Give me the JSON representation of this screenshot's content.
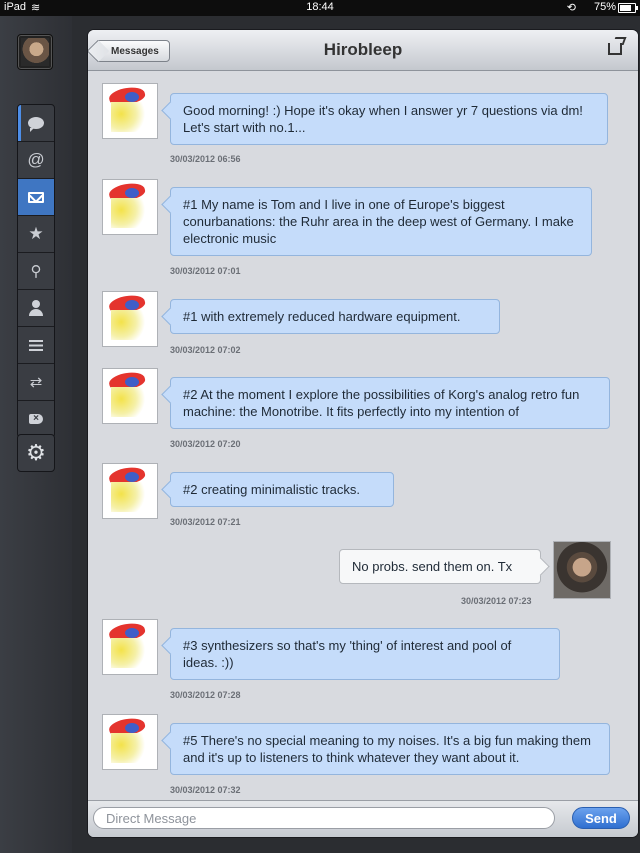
{
  "status_bar": {
    "device": "iPad",
    "time": "18:44",
    "battery": "75%"
  },
  "header": {
    "back_label": "Messages",
    "title": "Hirobleep"
  },
  "messages": [
    {
      "text": "Good morning! :) Hope it's okay when I answer yr 7 questions via dm! Let's start with no.1...",
      "time": "30/03/2012 06:56",
      "direction": "in"
    },
    {
      "text": "#1 My name is Tom and I live in one of Europe's biggest conurbanations: the Ruhr area in the deep west of Germany.  I make electronic music",
      "time": "30/03/2012 07:01",
      "direction": "in"
    },
    {
      "text": "#1 with extremely reduced hardware equipment.",
      "time": "30/03/2012 07:02",
      "direction": "in"
    },
    {
      "text": "#2 At the moment I explore the possibilities of Korg's analog retro fun machine: the Monotribe. It fits perfectly into my intention of",
      "time": "30/03/2012 07:20",
      "direction": "in"
    },
    {
      "text": "#2 creating minimalistic tracks.",
      "time": "30/03/2012 07:21",
      "direction": "in"
    },
    {
      "text": "No probs. send them on. Tx",
      "time": "30/03/2012 07:23",
      "direction": "out"
    },
    {
      "text": "#3 synthesizers so that's my 'thing' of interest and pool of ideas. :))",
      "time": "30/03/2012 07:28",
      "direction": "in"
    },
    {
      "text": "#5 There's no special meaning to my noises. It's a big fun making them and it's up to listeners to think whatever they want about it.",
      "time": "30/03/2012 07:32",
      "direction": "in"
    }
  ],
  "composer": {
    "placeholder": "Direct Message",
    "send_label": "Send"
  },
  "colors": {
    "incoming_bubble": "#c5dcfa",
    "outgoing_bubble": "#f7f8f9",
    "accent": "#3f76c2"
  }
}
